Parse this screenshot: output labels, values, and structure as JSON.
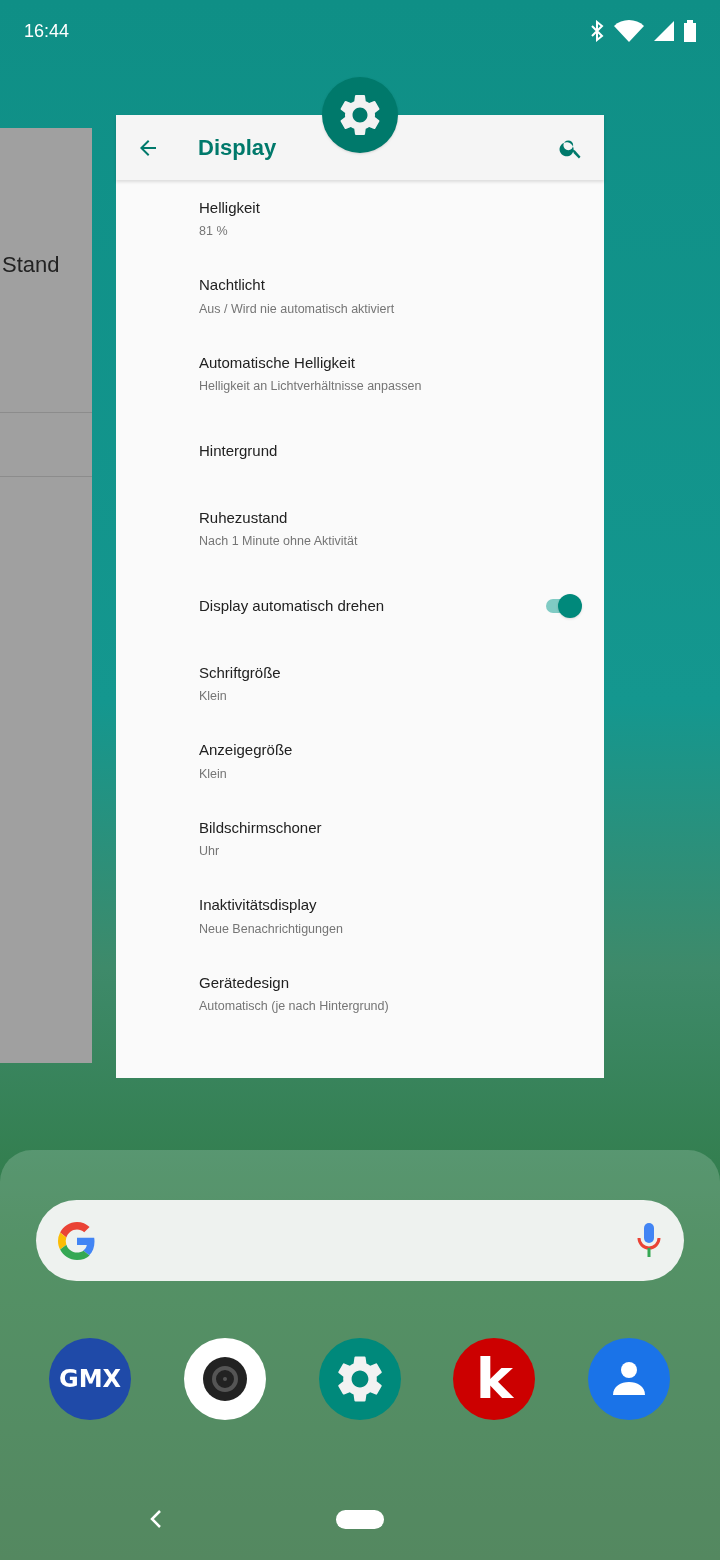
{
  "status_bar": {
    "time": "16:44"
  },
  "background_card": {
    "text": "Stand"
  },
  "settings_window": {
    "title": "Display",
    "items": [
      {
        "kind": "text",
        "title": "Helligkeit",
        "summary": "81 %"
      },
      {
        "kind": "text",
        "title": "Nachtlicht",
        "summary": "Aus / Wird nie automatisch aktiviert"
      },
      {
        "kind": "text",
        "title": "Automatische Helligkeit",
        "summary": "Helligkeit an Lichtverhältnisse anpassen"
      },
      {
        "kind": "text",
        "title": "Hintergrund"
      },
      {
        "kind": "text",
        "title": "Ruhezustand",
        "summary": "Nach 1 Minute ohne Aktivität"
      },
      {
        "kind": "toggle",
        "title": "Display automatisch drehen",
        "on": true
      },
      {
        "kind": "text",
        "title": "Schriftgröße",
        "summary": "Klein"
      },
      {
        "kind": "text",
        "title": "Anzeigegröße",
        "summary": "Klein"
      },
      {
        "kind": "text",
        "title": "Bildschirmschoner",
        "summary": "Uhr"
      },
      {
        "kind": "text",
        "title": "Inaktivitätsdisplay",
        "summary": "Neue Benachrichtigungen"
      },
      {
        "kind": "text",
        "title": "Gerätedesign",
        "summary": "Automatisch (je nach Hintergrund)"
      }
    ]
  },
  "dock": [
    {
      "kind": "text_logo",
      "label": "GMX",
      "color": "#1f4aa8"
    },
    {
      "kind": "camera",
      "color": "#ffffff"
    },
    {
      "kind": "settings",
      "color": "#00897b"
    },
    {
      "kind": "text_logo",
      "label": "k",
      "color": "#cc0000"
    },
    {
      "kind": "contacts",
      "color": "#1a73e8"
    }
  ]
}
